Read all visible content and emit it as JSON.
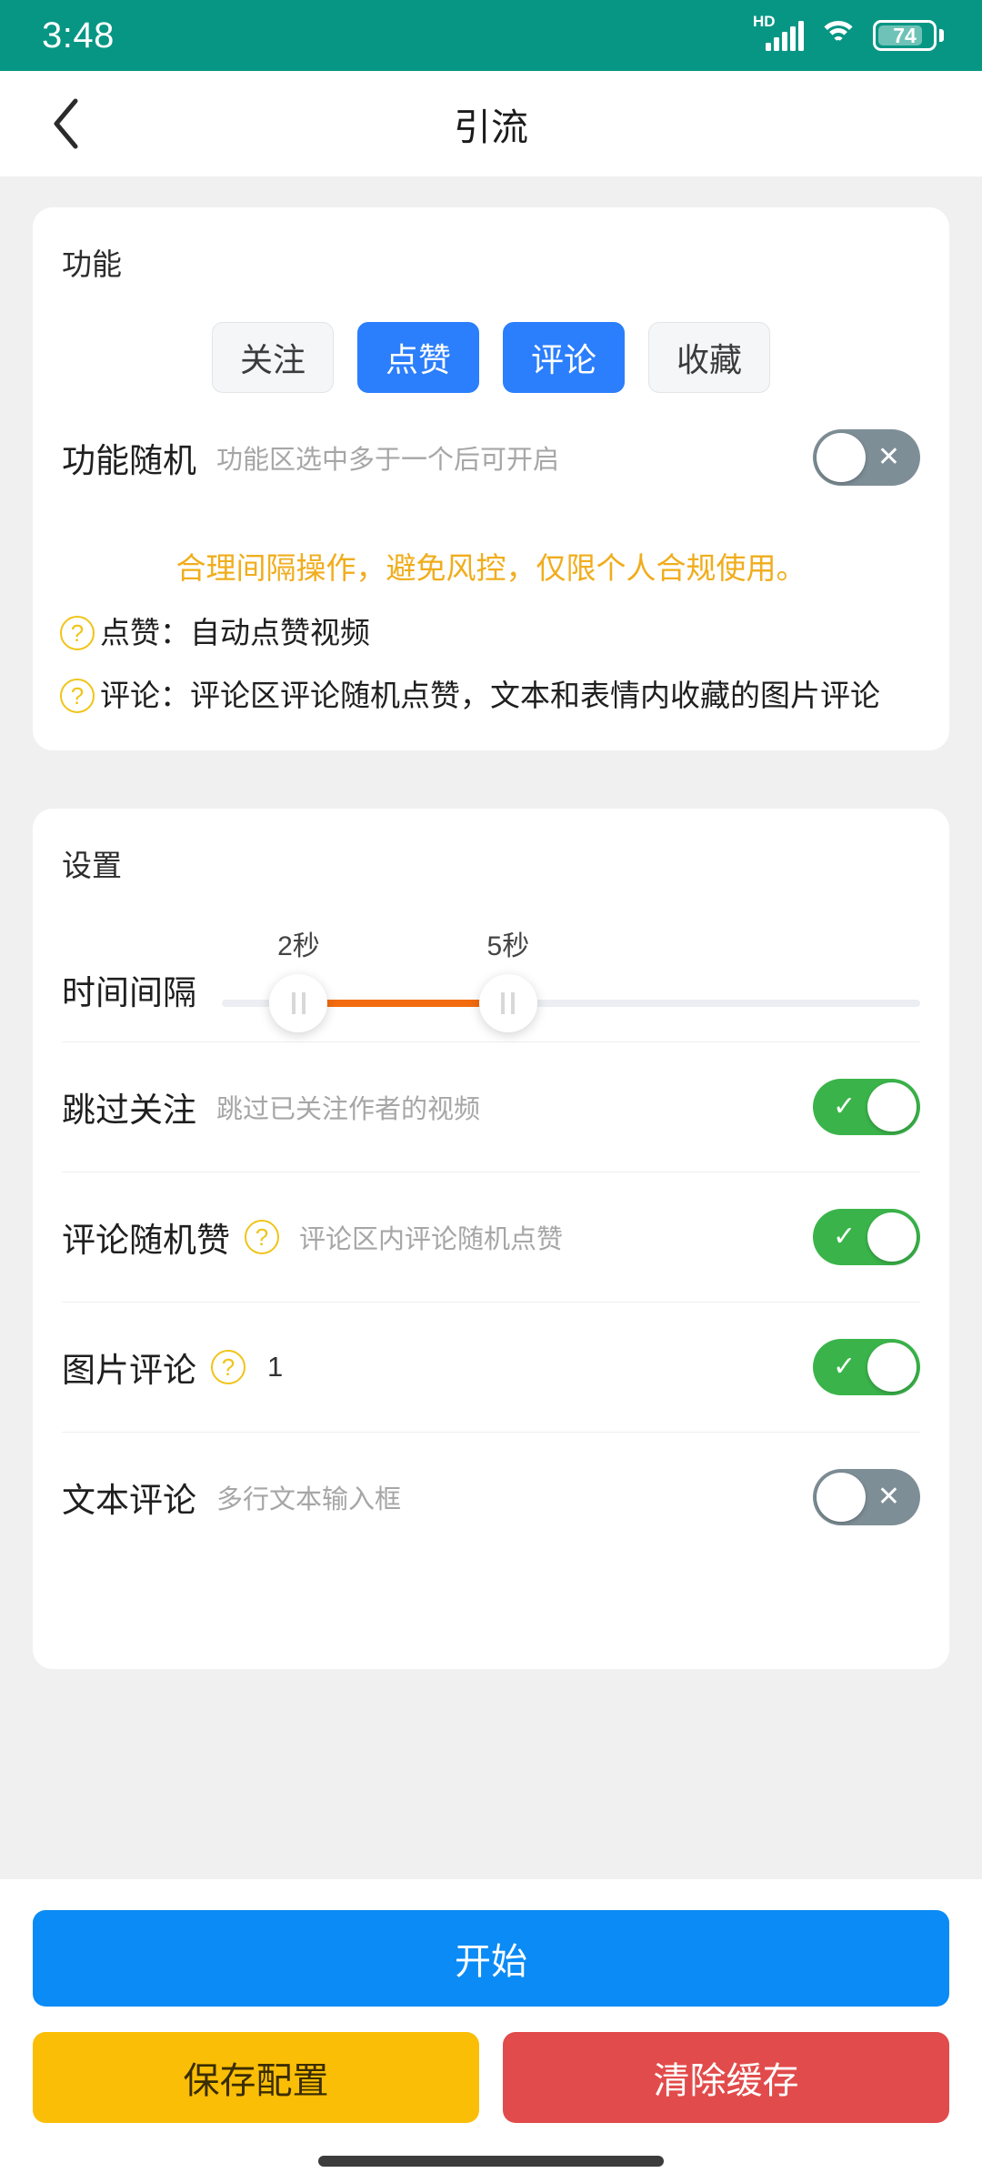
{
  "status_bar": {
    "time": "3:48",
    "network_label": "HD",
    "battery_percent": "74",
    "icons": [
      "hd-signal-icon",
      "wifi-icon",
      "battery-icon"
    ]
  },
  "nav": {
    "title": "引流",
    "back_icon": "back-chevron-icon"
  },
  "function_card": {
    "title": "功能",
    "chips": [
      {
        "label": "关注",
        "active": false
      },
      {
        "label": "点赞",
        "active": true
      },
      {
        "label": "评论",
        "active": true
      },
      {
        "label": "收藏",
        "active": false
      }
    ],
    "random_row": {
      "label": "功能随机",
      "hint": "功能区选中多于一个后可开启",
      "toggle_state": "off",
      "toggle_mark": "✕"
    },
    "notice": "合理间隔操作，避免风控，仅限个人合规使用。",
    "help_lines": [
      {
        "icon": "question-circle-icon",
        "text": "点赞：自动点赞视频"
      },
      {
        "icon": "question-circle-icon",
        "text": "评论：评论区评论随机点赞，文本和表情内收藏的图片评论"
      }
    ]
  },
  "settings_card": {
    "title": "设置",
    "interval": {
      "label": "时间间隔",
      "min_tip": "2秒",
      "max_tip": "5秒",
      "min_percent": 11,
      "max_percent": 41,
      "fill_color": "#f26b0f"
    },
    "rows": [
      {
        "label": "跳过关注",
        "hint": "跳过已关注作者的视频",
        "value": "",
        "has_question": false,
        "toggle_state": "on",
        "toggle_mark": "✓"
      },
      {
        "label": "评论随机赞",
        "hint": "评论区内评论随机点赞",
        "value": "",
        "has_question": true,
        "toggle_state": "on",
        "toggle_mark": "✓"
      },
      {
        "label": "图片评论",
        "hint": "",
        "value": "1",
        "has_question": true,
        "toggle_state": "on",
        "toggle_mark": "✓"
      },
      {
        "label": "文本评论",
        "hint": "多行文本输入框",
        "value": "",
        "has_question": false,
        "toggle_state": "off",
        "toggle_mark": "✕"
      }
    ]
  },
  "footer": {
    "start_label": "开始",
    "save_label": "保存配置",
    "clear_label": "清除缓存"
  },
  "colors": {
    "status_bar": "#079684",
    "accent_blue": "#2b7efc",
    "primary_blue": "#0b8bf5",
    "toggle_on": "#3ab44a",
    "toggle_off": "#7e8e96",
    "notice": "#f0ad1c",
    "save": "#fbbe07",
    "clear": "#e24b4b",
    "slider_fill": "#f26b0f"
  }
}
